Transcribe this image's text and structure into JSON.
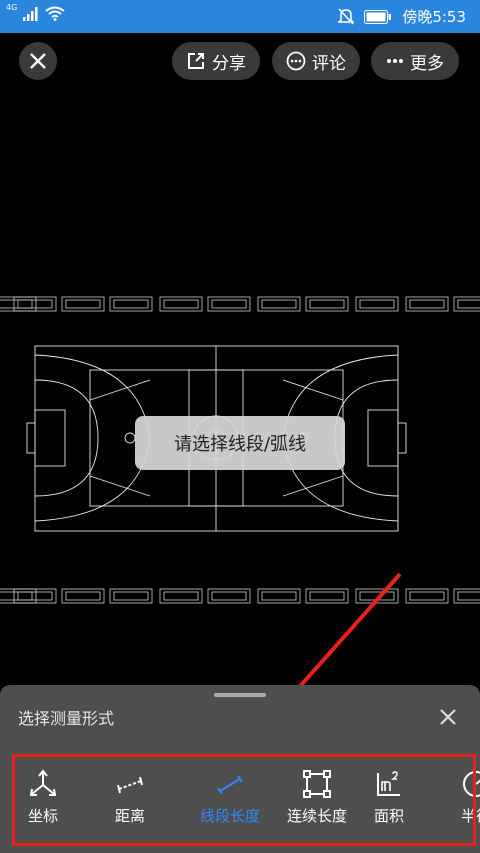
{
  "status_bar": {
    "network": "4G",
    "time": "傍晚5:53",
    "icons": [
      "signal-icon",
      "wifi-icon",
      "mute-icon",
      "battery-icon"
    ]
  },
  "toolbar": {
    "close_icon": "close-icon",
    "share_label": "分享",
    "comment_label": "评论",
    "more_label": "更多"
  },
  "toast": {
    "text": "请选择线段/弧线"
  },
  "measure_panel": {
    "title": "选择测量形式",
    "tools": [
      {
        "label": "坐标",
        "icon": "coordinate-icon",
        "active": false
      },
      {
        "label": "距离",
        "icon": "distance-icon",
        "active": false
      },
      {
        "label": "线段长度",
        "icon": "segment-length-icon",
        "active": true
      },
      {
        "label": "连续长度",
        "icon": "continuous-length-icon",
        "active": false
      },
      {
        "label": "面积",
        "icon": "area-icon",
        "active": false
      },
      {
        "label": "半径",
        "icon": "radius-icon",
        "active": false
      }
    ]
  },
  "colors": {
    "status_bar": "#2a86dd",
    "active_tool": "#2f8bff",
    "annotation": "#e8221a",
    "panel_bg": "#4e4e4e"
  }
}
